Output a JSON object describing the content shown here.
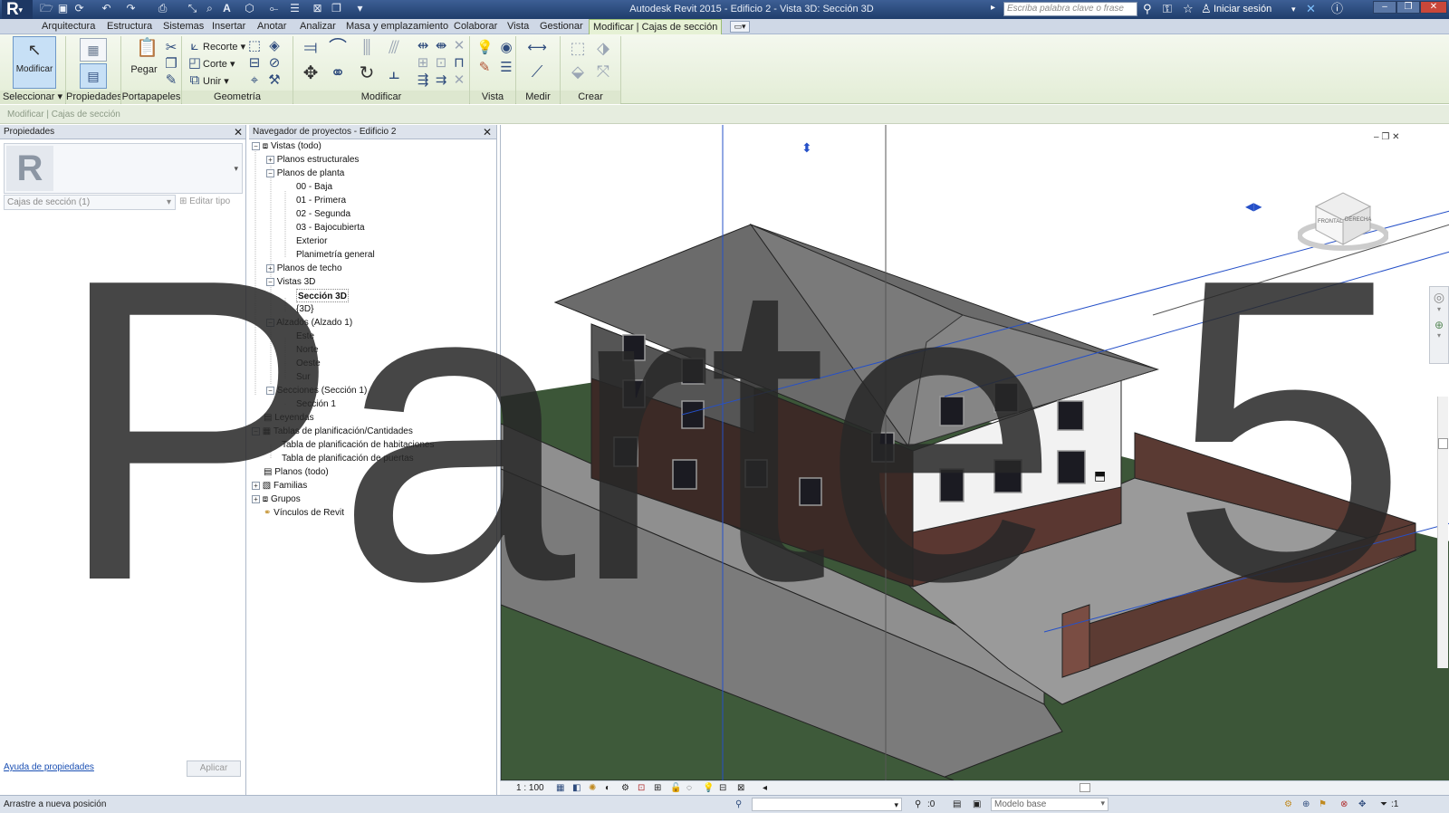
{
  "app": {
    "title": "Autodesk Revit 2015 -    Edificio 2 - Vista 3D: Sección 3D",
    "search_placeholder": "Escriba palabra clave o frase",
    "signin": "Iniciar sesión"
  },
  "ribbon": {
    "tabs": [
      "Arquitectura",
      "Estructura",
      "Sistemas",
      "Insertar",
      "Anotar",
      "Analizar",
      "Masa y emplazamiento",
      "Colaborar",
      "Vista",
      "Gestionar",
      "Modificar | Cajas de sección"
    ],
    "active_tab": "Modificar | Cajas de sección",
    "modify_label": "Modificar",
    "paste_label": "Pegar",
    "geometry_items": [
      "Recorte",
      "Corte",
      "Unir"
    ],
    "panels": [
      "Seleccionar",
      "Propiedades",
      "Portapapeles",
      "Geometría",
      "Modificar",
      "Vista",
      "Medir",
      "Crear"
    ]
  },
  "context_bar": "Modificar | Cajas de sección",
  "properties": {
    "header": "Propiedades",
    "type_selector": "Cajas de sección (1)",
    "edit_type": "Editar tipo",
    "help_link": "Ayuda de propiedades",
    "apply": "Aplicar"
  },
  "browser": {
    "header": "Navegador de proyectos - Edificio 2",
    "tree": {
      "views": "Vistas (todo)",
      "structural": "Planos estructurales",
      "floor_plans": "Planos de planta",
      "plans": [
        "00 - Baja",
        "01 - Primera",
        "02 - Segunda",
        "03 - Bajocubierta",
        "Exterior",
        "Planimetría general"
      ],
      "ceiling": "Planos de techo",
      "views3d": "Vistas 3D",
      "v3d": [
        "Sección 3D",
        "{3D}"
      ],
      "elevations": "Alzados (Alzado 1)",
      "elev": [
        "Este",
        "Norte",
        "Oeste",
        "Sur"
      ],
      "sections": "Secciones (Sección 1)",
      "sect": [
        "Sección 1"
      ],
      "legends": "Leyendas",
      "schedules": "Tablas de planificación/Cantidades",
      "sched": [
        "Tabla de planificación de habitaciones",
        "Tabla de planificación de puertas"
      ],
      "sheets": "Planos (todo)",
      "families": "Familias",
      "groups": "Grupos",
      "links": "Vínculos de Revit"
    }
  },
  "viewport": {
    "scale": "1 : 100",
    "viewcube_front": "FRONTAL",
    "viewcube_right": "DERECHA"
  },
  "status": {
    "message": "Arrastre a nueva posición",
    "coord": ":0",
    "model": "Modelo base",
    "filter": ":1"
  },
  "overlay_text": "Parte 5",
  "colors": {
    "titlebar": "#2b4a7e",
    "ribbon": "#e6f0dc",
    "active_tab": "#e6f1d5",
    "roof": "#6a6a6a",
    "brick": "#4a2e28",
    "grass": "#3f5a3a",
    "wall": "#5c3b33"
  }
}
